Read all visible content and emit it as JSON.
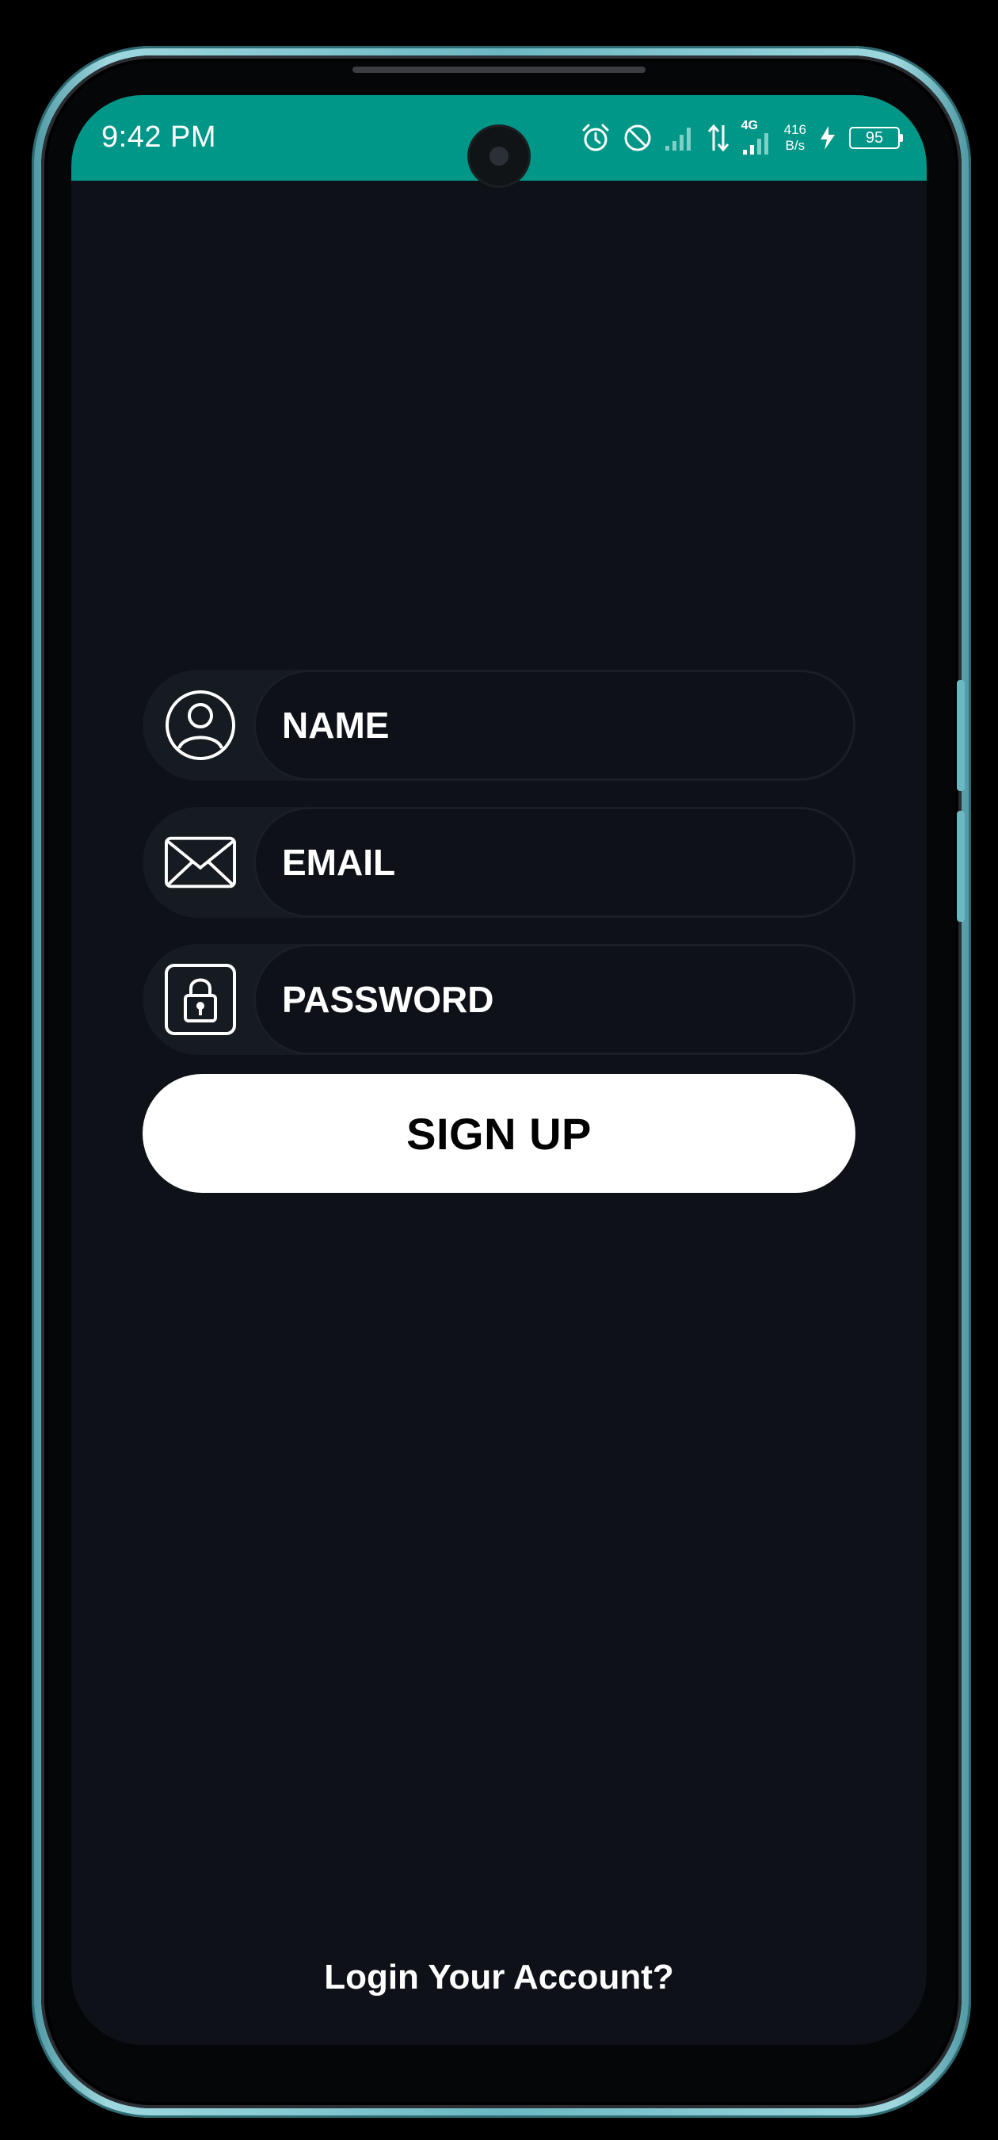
{
  "status_bar": {
    "time": "9:42 PM",
    "network_type": "4G",
    "net_speed_value": "416",
    "net_speed_unit": "B/s",
    "battery_level": "95",
    "background_color": "#009688"
  },
  "form": {
    "name_placeholder": "NAME",
    "email_placeholder": "EMAIL",
    "password_placeholder": "PASSWORD",
    "name_icon": "user-icon",
    "email_icon": "envelope-icon",
    "password_icon": "lock-icon"
  },
  "actions": {
    "signup_label": "SIGN UP",
    "login_link": "Login Your Account?"
  },
  "colors": {
    "screen_background": "#0e1117",
    "accent": "#009688",
    "button_background": "#ffffff"
  }
}
